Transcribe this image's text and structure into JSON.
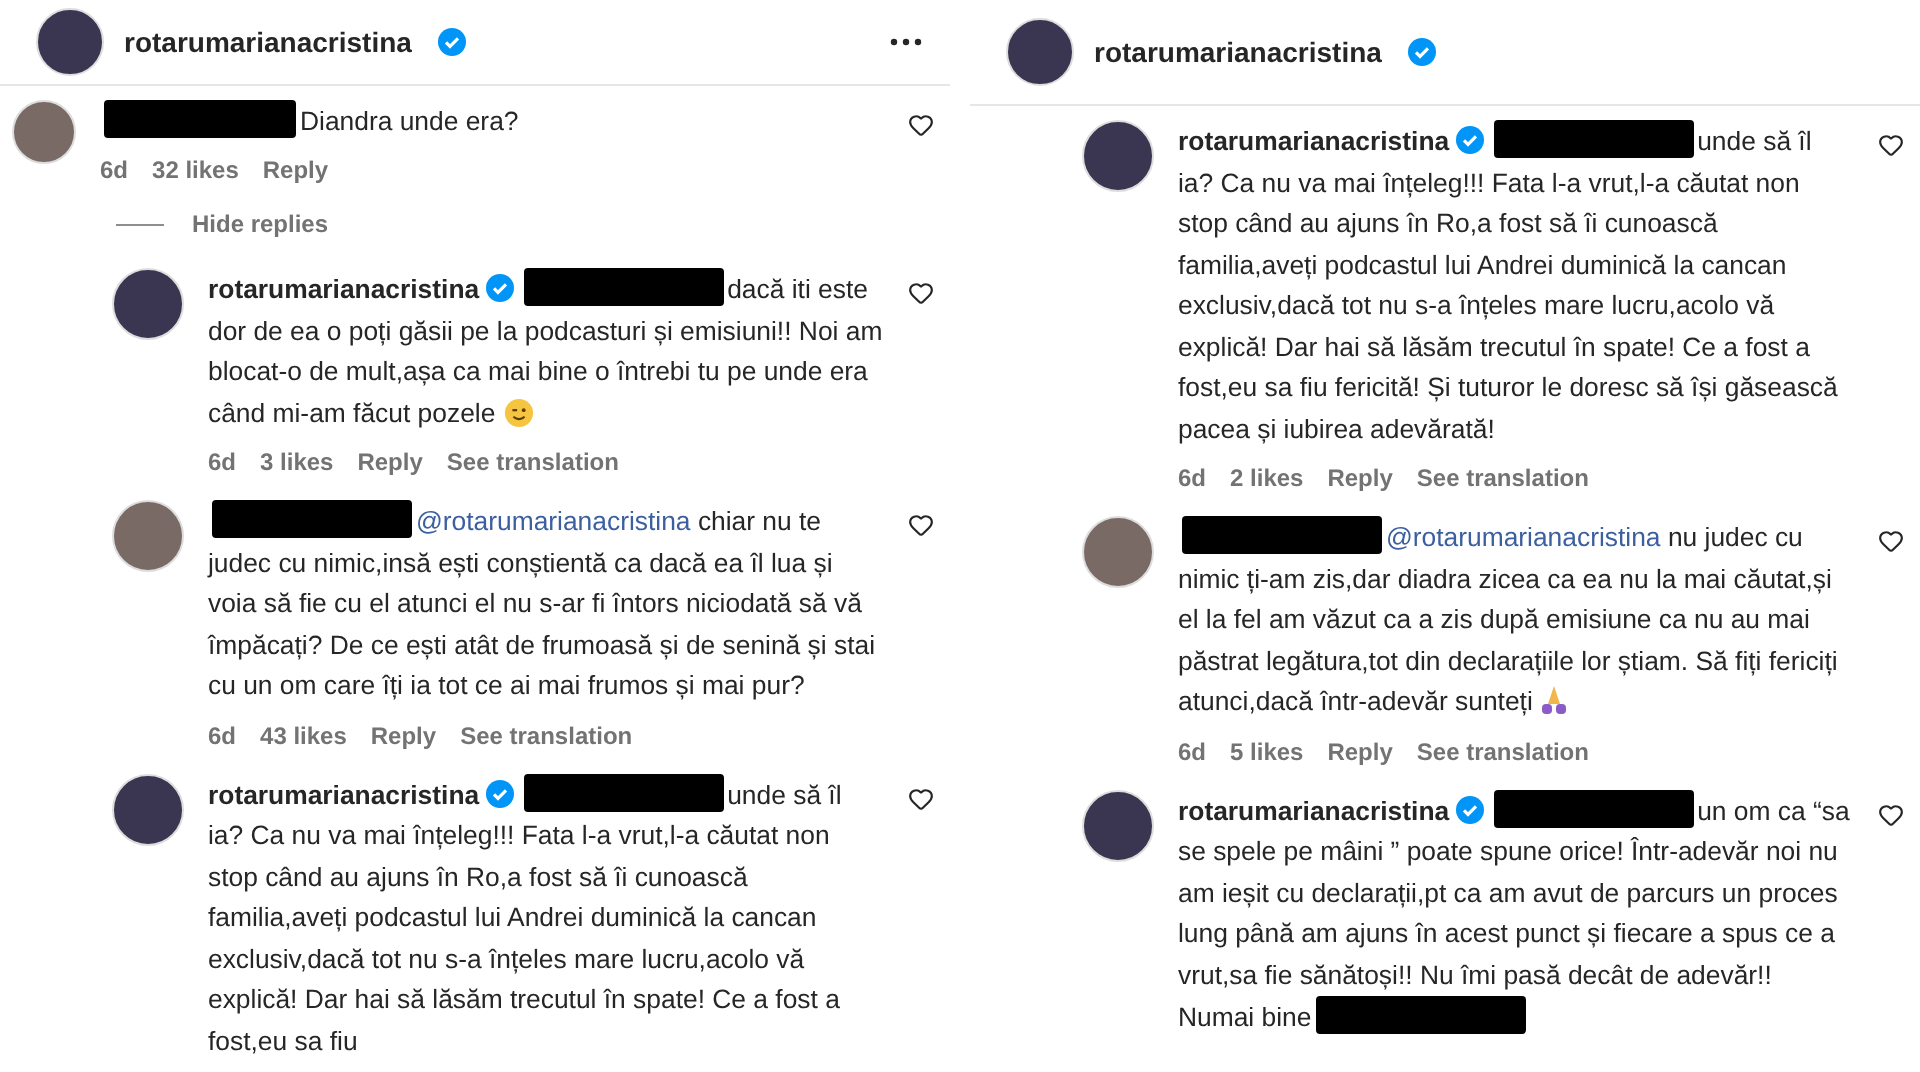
{
  "panels": [
    {
      "header": {
        "username": "rotarumarianacristina",
        "verified": true,
        "more_menu": true
      },
      "items": [
        {
          "kind": "comment",
          "redacted": true,
          "verified": false,
          "text": "Diandra unde era?",
          "time": "6d",
          "likes": "32 likes",
          "reply": "Reply"
        },
        {
          "kind": "toggle",
          "label": "Hide replies"
        },
        {
          "kind": "reply",
          "author": "rotarumarianacristina",
          "verified": true,
          "redacted": true,
          "text": "dacă iti este dor de ea o poți găsii pe la podcasturi și emisiuni!! Noi am blocat-o de mult,așa ca mai bine o întrebi tu pe unde era când mi-am făcut pozele",
          "emoji": {
            "kind": "wink"
          },
          "time": "6d",
          "likes": "3 likes",
          "reply": "Reply",
          "translation": "See translation"
        },
        {
          "kind": "reply",
          "verified": false,
          "redacted": true,
          "mention": "@rotarumarianacristina",
          "text": "chiar nu te judec cu nimic,insă ești conștientă ca dacă ea îl lua și voia să fie cu el atunci el nu s-ar fi întors niciodată să vă împăcați? De ce ești atât de frumoasă și de senină și stai cu un om care îți ia tot ce ai mai frumos și mai pur?",
          "time": "6d",
          "likes": "43 likes",
          "reply": "Reply",
          "translation": "See translation"
        },
        {
          "kind": "reply",
          "author": "rotarumarianacristina",
          "verified": true,
          "redacted": true,
          "text": "unde să îl ia? Ca nu va mai înțeleg!!! Fata l-a vrut,l-a căutat non stop când au ajuns în Ro,a fost să îi cunoască familia,aveți podcastul lui Andrei duminică la cancan exclusiv,dacă tot nu s-a înțeles mare lucru,acolo vă explică! Dar hai să lăsăm trecutul în spate! Ce a fost a fost,eu sa fiu"
        }
      ]
    },
    {
      "header": {
        "username": "rotarumarianacristina",
        "verified": true,
        "more_menu": false
      },
      "items": [
        {
          "kind": "reply",
          "author": "rotarumarianacristina",
          "verified": true,
          "redacted": true,
          "text": "unde să îl ia? Ca nu va mai înțeleg!!! Fata l-a vrut,l-a căutat non stop când au ajuns în Ro,a fost să îi cunoască familia,aveți podcastul lui Andrei duminică la cancan exclusiv,dacă tot nu s-a înțeles mare lucru,acolo vă explică! Dar hai să lăsăm trecutul în spate! Ce a fost a fost,eu sa fiu fericită! Și tuturor le doresc să își găsească pacea și iubirea adevărată!",
          "time": "6d",
          "likes": "2 likes",
          "reply": "Reply",
          "translation": "See translation"
        },
        {
          "kind": "reply",
          "verified": false,
          "redacted": true,
          "mention": "@rotarumarianacristina",
          "text": "nu judec cu nimic ți-am zis,dar diadra zicea ca ea nu la mai căutat,și el la fel am văzut ca a zis după emisiune ca nu au mai păstrat legătura,tot din declarațiile lor știam. Să fiți fericiți atunci,dacă într-adevăr sunteți",
          "emoji": {
            "kind": "pray"
          },
          "time": "6d",
          "likes": "5 likes",
          "reply": "Reply",
          "translation": "See translation"
        },
        {
          "kind": "reply",
          "author": "rotarumarianacristina",
          "verified": true,
          "redacted": true,
          "text": "un om ca “sa se spele pe mâini ” poate spune orice! Într-adevăr noi nu am ieșit cu declarații,pt ca am avut de parcurs un proces lung până am ajuns în acest punct și fiecare a spus ce a vrut,sa fie sănătoși!! Nu îmi pasă decât de adevăr!! Numai bine",
          "trailing_redaction": true
        }
      ]
    }
  ]
}
